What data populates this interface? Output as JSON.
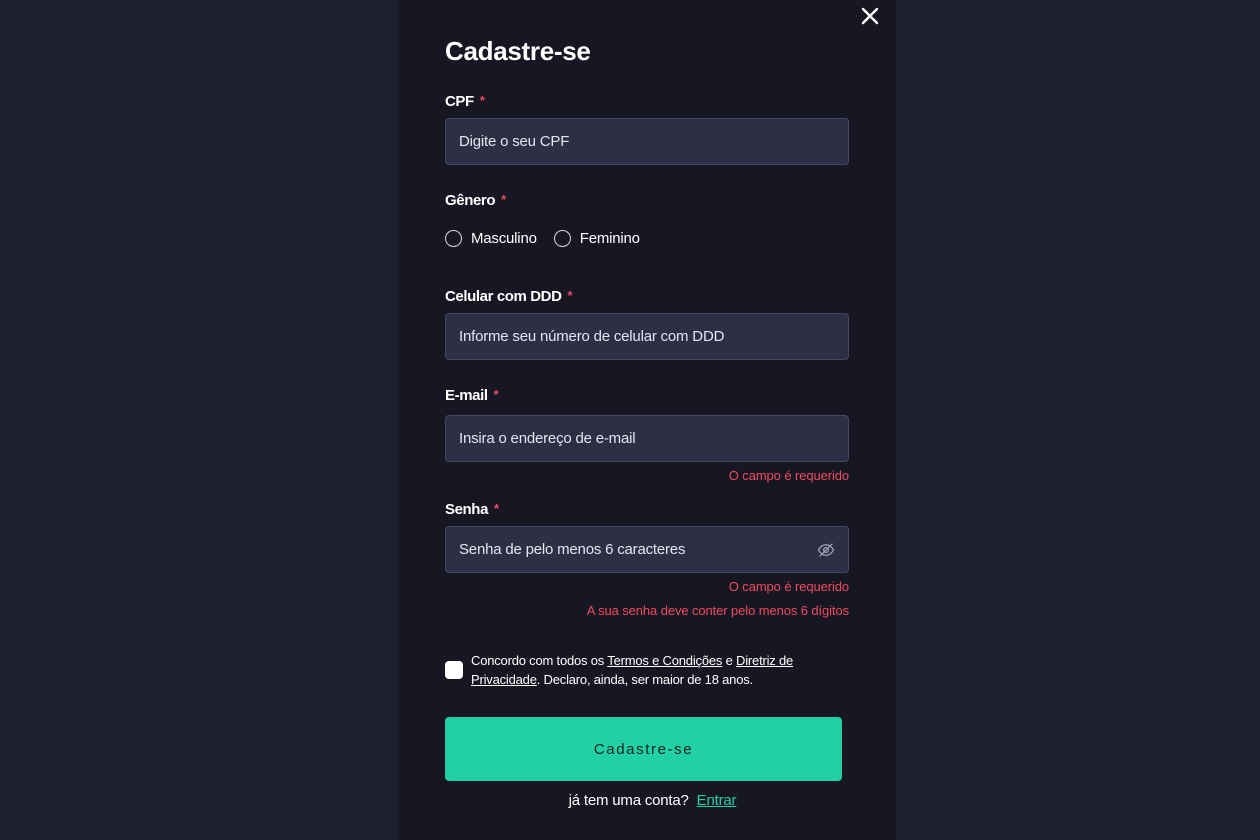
{
  "modal": {
    "title": "Cadastre-se",
    "required_mark": "*"
  },
  "cpf": {
    "label": "CPF",
    "placeholder": "Digite o seu CPF"
  },
  "gender": {
    "label": "Gênero",
    "options": [
      "Masculino",
      "Feminino"
    ]
  },
  "phone": {
    "label": "Celular com DDD",
    "placeholder": "Informe seu número de celular com DDD"
  },
  "email": {
    "label": "E-mail",
    "placeholder": "Insira o endereço de e-mail",
    "error": "O campo é requerido"
  },
  "password": {
    "label": "Senha",
    "placeholder": "Senha de pelo menos 6 caracteres",
    "error_required": "O campo é requerido",
    "error_length": "A sua senha deve conter pelo menos 6 dígitos",
    "toggle_icon": "eye-off-icon"
  },
  "terms": {
    "text_1": "Concordo com todos os ",
    "link_terms": "Termos e Condições",
    "text_2": " e ",
    "link_privacy": "Diretriz de Privacidade",
    "text_3": ". Declaro, ainda, ser maior de 18 anos.",
    "checked": false
  },
  "submit": {
    "label": "Cadastre-se"
  },
  "login": {
    "question": "já tem uma conta?",
    "link": "Entrar"
  },
  "colors": {
    "accent": "#22d0a5",
    "error": "#ef4b5f",
    "modal_bg": "#161722",
    "page_bg": "#1e1f2e",
    "input_bg": "#2e2f44"
  }
}
